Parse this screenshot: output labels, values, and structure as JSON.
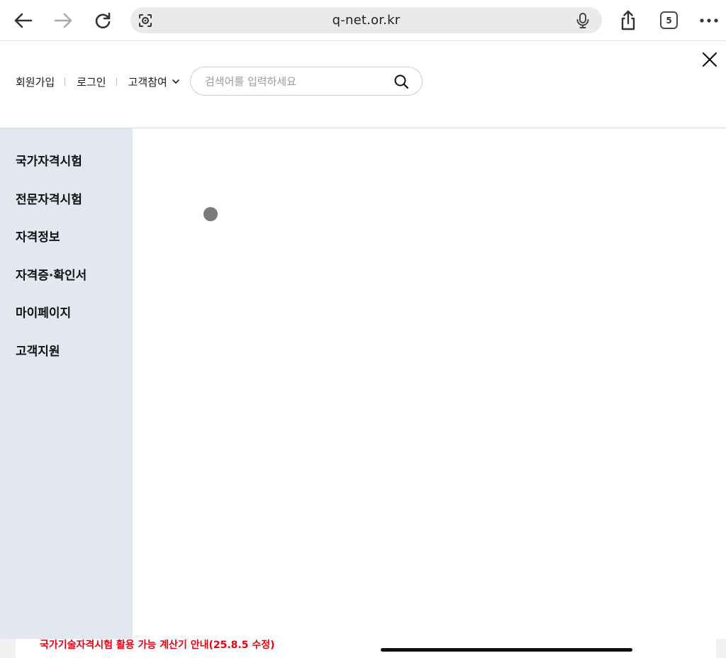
{
  "browser": {
    "url": "q-net.or.kr",
    "tab_count": "5",
    "icons": [
      "back-arrow-icon",
      "forward-arrow-icon",
      "reload-icon",
      "site-settings-icon",
      "microphone-icon",
      "share-icon",
      "tabs-icon",
      "more-icon"
    ]
  },
  "header": {
    "links": {
      "signup": "회원가입",
      "login": "로그인",
      "customer": "고객참여"
    },
    "search": {
      "placeholder": "검색어를 입력하세요",
      "value": ""
    }
  },
  "side_menu": {
    "items": [
      {
        "label": "국가자격시험"
      },
      {
        "label": "전문자격시험"
      },
      {
        "label": "자격정보"
      },
      {
        "label": "자격증·확인서"
      },
      {
        "label": "마이페이지"
      },
      {
        "label": "고객지원"
      }
    ]
  },
  "footer": {
    "notice": "국가기술자격시험 활용 가능 계산기 안내(25.8.5 수정)"
  },
  "colors": {
    "side_menu_bg": "#e3e7ef",
    "notice_red": "#e60012",
    "url_bar_bg": "#e9eaec"
  }
}
